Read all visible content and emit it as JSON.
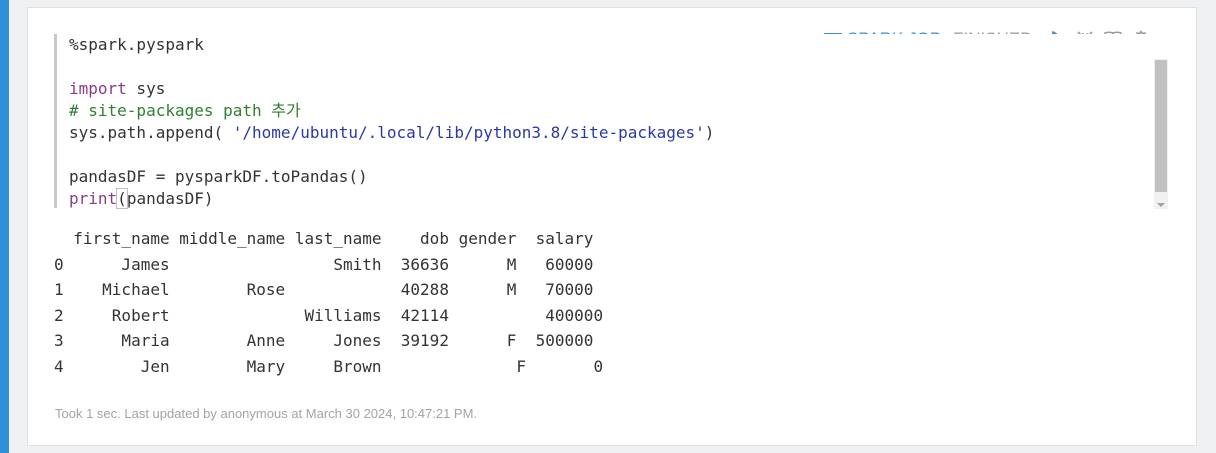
{
  "paragraph": {
    "controls": {
      "job_label": "SPARK JOB",
      "status": "FINISHED",
      "icons": [
        "run-icon",
        "collapse-icon",
        "book-icon",
        "settings-icon"
      ]
    },
    "code": {
      "lines": [
        {
          "parts": [
            {
              "text": "%spark.pyspark",
              "type": "plain"
            }
          ]
        },
        {
          "parts": []
        },
        {
          "parts": [
            {
              "text": "import",
              "type": "kw"
            },
            {
              "text": " sys",
              "type": "plain"
            }
          ]
        },
        {
          "parts": [
            {
              "text": "# site-packages path 추가",
              "type": "cm"
            }
          ]
        },
        {
          "parts": [
            {
              "text": "sys.path.append( ",
              "type": "plain"
            },
            {
              "text": "'/home/ubuntu/.local/lib/python3.8/site-packages'",
              "type": "str"
            },
            {
              "text": ")",
              "type": "plain"
            }
          ]
        },
        {
          "parts": []
        },
        {
          "parts": [
            {
              "text": "pandasDF = pysparkDF.toPandas()",
              "type": "plain"
            }
          ]
        },
        {
          "parts": [
            {
              "text": "print",
              "type": "kw"
            },
            {
              "text": "(",
              "type": "paren"
            },
            {
              "text": "pandasDF)",
              "type": "plain"
            }
          ]
        }
      ]
    },
    "output": {
      "lines": [
        "  first_name middle_name last_name    dob gender  salary",
        "0      James                 Smith  36636      M   60000",
        "1    Michael        Rose            40288      M   70000",
        "2     Robert              Williams  42114          400000",
        "3      Maria        Anne     Jones  39192      F  500000",
        "4        Jen        Mary     Brown              F       0"
      ]
    },
    "footer": "Took 1 sec. Last updated by anonymous at March 30 2024, 10:47:21 PM."
  },
  "colors": {
    "accent": "#3a8fd1",
    "keyword": "#8b3c86",
    "comment": "#2f7f2f",
    "string": "#2a39a8"
  }
}
